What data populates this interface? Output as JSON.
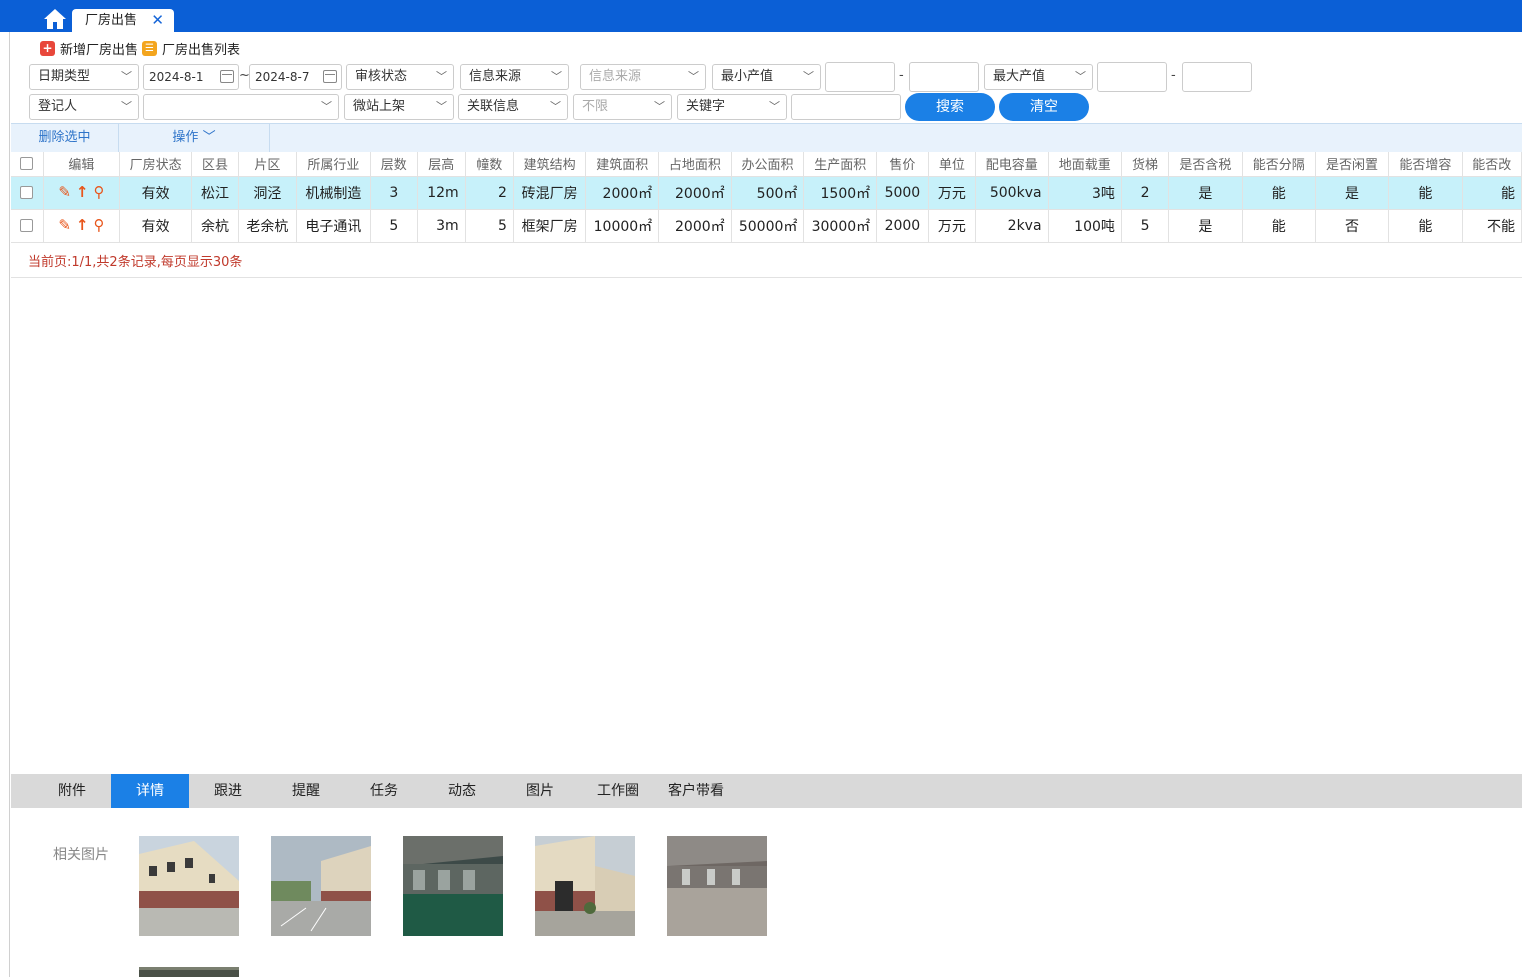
{
  "tabs": {
    "active_tab": "厂房出售",
    "close": "✕"
  },
  "actions": {
    "add": "新增厂房出售",
    "list": "厂房出售列表"
  },
  "filters": {
    "date_type": "日期类型",
    "date_from": "2024-8-1",
    "date_tilde": "~",
    "date_to": "2024-8-7",
    "audit_status": "审核状态",
    "info_source1": "信息来源",
    "info_source2": "信息来源",
    "min_value": "最小产值",
    "max_value": "最大产值",
    "dash": "-",
    "registrar": "登记人",
    "wechat_listing": "微站上架",
    "linked_info": "关联信息",
    "unlimited": "不限",
    "keyword": "关键字",
    "search_btn": "搜索",
    "clear_btn": "清空"
  },
  "toolbar": {
    "delete_selected": "删除选中",
    "operations": "操作"
  },
  "table": {
    "headers": [
      "编辑",
      "厂房状态",
      "区县",
      "片区",
      "所属行业",
      "层数",
      "层高",
      "幢数",
      "建筑结构",
      "建筑面积",
      "占地面积",
      "办公面积",
      "生产面积",
      "售价",
      "单位",
      "配电容量",
      "地面载重",
      "货梯",
      "是否含税",
      "能否分隔",
      "是否闲置",
      "能否增容",
      "能否改"
    ],
    "rows": [
      [
        "有效",
        "松江",
        "洞泾",
        "机械制造",
        "3",
        "12m",
        "2",
        "砖混厂房",
        "2000㎡",
        "2000㎡",
        "500㎡",
        "1500㎡",
        "5000",
        "万元",
        "500kva",
        "3吨",
        "2",
        "是",
        "能",
        "是",
        "能",
        "能"
      ],
      [
        "有效",
        "余杭",
        "老余杭",
        "电子通讯",
        "5",
        "3m",
        "5",
        "框架厂房",
        "10000㎡",
        "2000㎡",
        "50000㎡",
        "30000㎡",
        "2000",
        "万元",
        "2kva",
        "100吨",
        "5",
        "是",
        "能",
        "否",
        "能",
        "不能"
      ]
    ]
  },
  "pager": "当前页:1/1,共2条记录,每页显示30条",
  "bottom_tabs": [
    "附件",
    "详情",
    "跟进",
    "提醒",
    "任务",
    "动态",
    "图片",
    "工作圈",
    "客户带看"
  ],
  "bottom_active": "详情",
  "photos": {
    "label": "相关图片"
  },
  "colors": {
    "accent": "#1b80e6",
    "topbar": "#0b5fd6",
    "selected_row": "#c7f1fa",
    "edit_icon": "#e8561c",
    "pager_text": "#c0392b"
  }
}
